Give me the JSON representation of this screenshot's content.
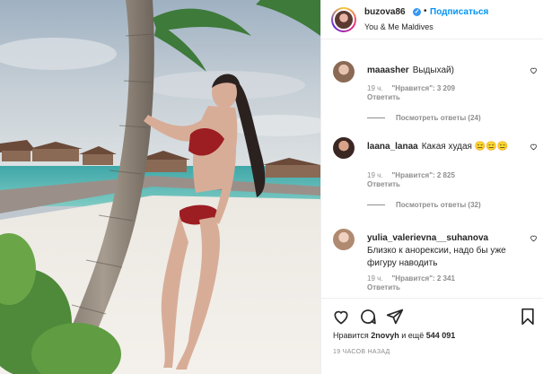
{
  "post": {
    "username": "buzova86",
    "follow_label": "Подписаться",
    "location": "You & Me Maldives",
    "verified_mark": "✓",
    "separator": "•"
  },
  "comments": [
    {
      "user": "maaasher",
      "text": "Выдыхай)",
      "time": "19 ч.",
      "likes_label": "\"Нравится\": 3 209",
      "reply": "Ответить",
      "view_replies": "Посмотреть ответы (24)"
    },
    {
      "user": "laana_lanaa",
      "text": "Какая худая 😑😑😑",
      "time": "19 ч.",
      "likes_label": "\"Нравится\": 2 825",
      "reply": "Ответить",
      "view_replies": "Посмотреть ответы (32)"
    },
    {
      "user": "yulia_valerievna__suhanova",
      "text": "Близко к анорексии, надо бы уже фигуру наводить",
      "time": "19 ч.",
      "likes_label": "\"Нравится\": 2 341",
      "reply": "Ответить"
    }
  ],
  "footer": {
    "likes_prefix": "Нравится",
    "likes_user": "2novyh",
    "likes_mid": "и ещё",
    "likes_count": "544 091",
    "timestamp": "19 ЧАСОВ НАЗАД"
  },
  "icons": [
    "heart-icon",
    "comment-icon",
    "share-icon",
    "bookmark-icon"
  ],
  "colors": {
    "link": "#0095f6",
    "verified": "#3897f0",
    "muted": "#8e8e8e",
    "text": "#262626"
  }
}
